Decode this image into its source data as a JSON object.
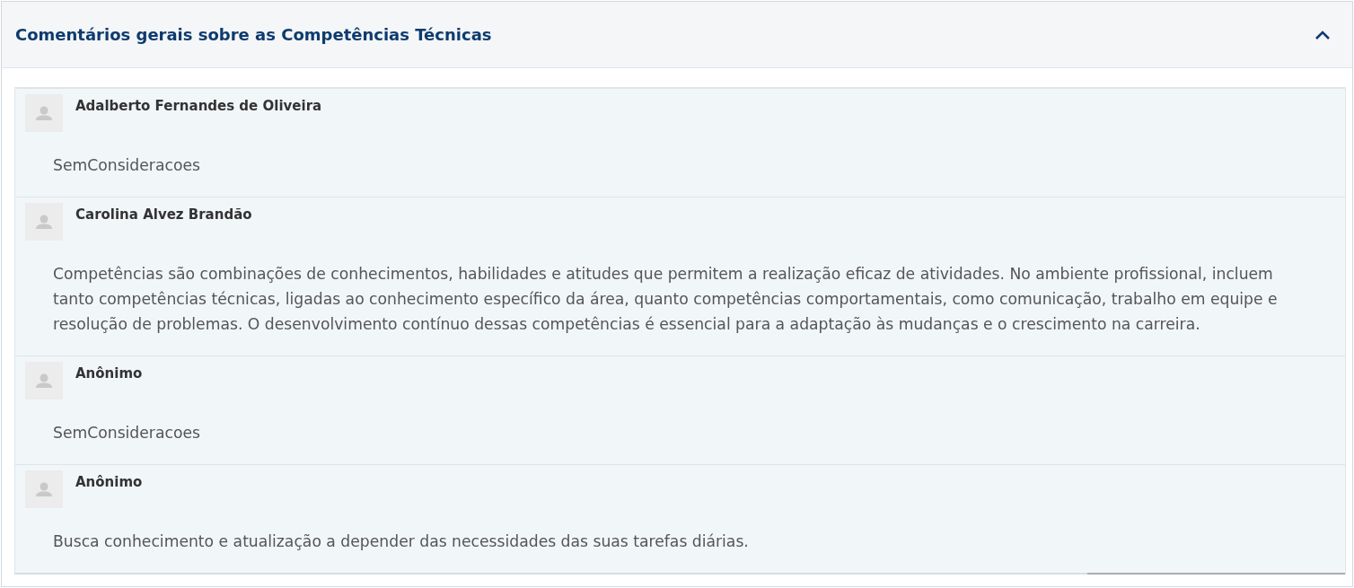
{
  "panel": {
    "title": "Comentários gerais sobre as Competências Técnicas",
    "expanded": true
  },
  "comments": [
    {
      "author": "Adalberto Fernandes de Oliveira",
      "text": "SemConsideracoes"
    },
    {
      "author": "Carolina Alvez Brandão",
      "text": "Competências são combinações de conhecimentos, habilidades e atitudes que permitem a realização eficaz de atividades. No ambiente profissional, incluem tanto competências técnicas, ligadas ao conhecimento específico da área, quanto competências comportamentais, como comunicação, trabalho em equipe e resolução de problemas. O desenvolvimento contínuo dessas competências é essencial para a adaptação às mudanças e o crescimento na carreira."
    },
    {
      "author": "Anônimo",
      "text": "SemConsideracoes"
    },
    {
      "author": "Anônimo",
      "text": "Busca conhecimento e atualização a depender das necessidades das suas tarefas diárias."
    }
  ]
}
